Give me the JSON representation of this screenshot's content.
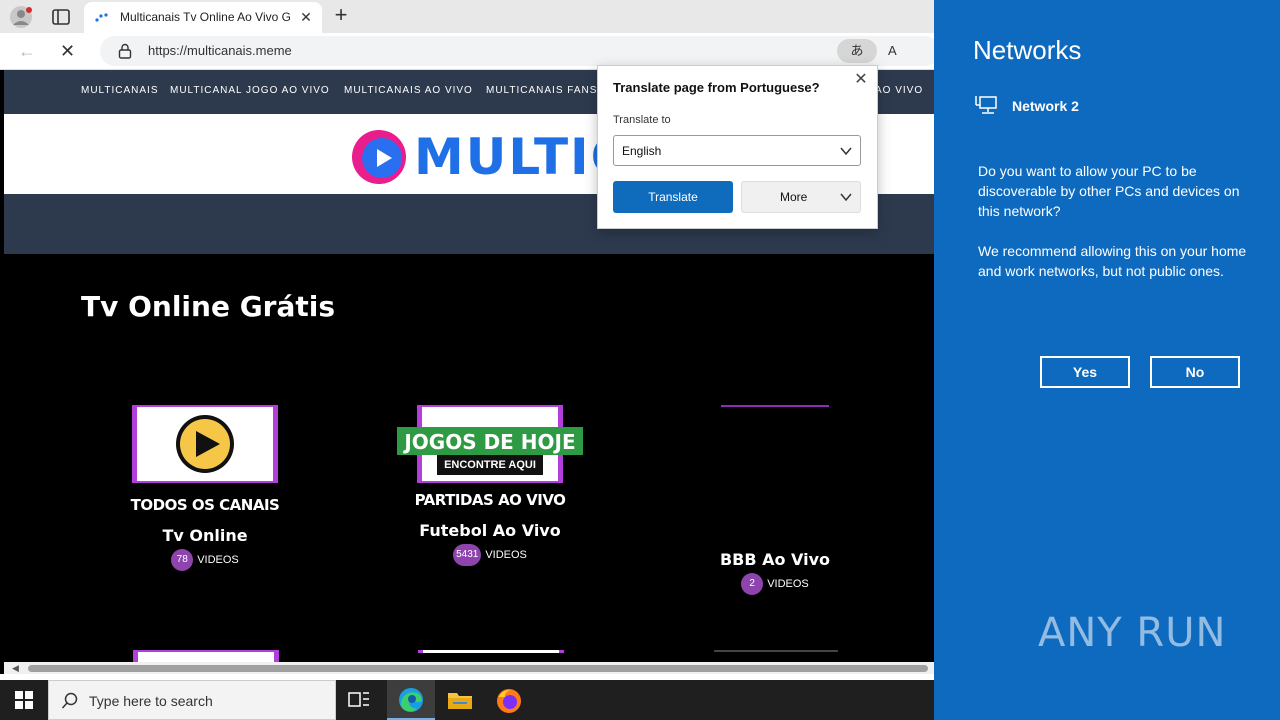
{
  "browser": {
    "tab_title": "Multicanais Tv Online Ao Vivo Gr",
    "url": "https://multicanais.meme",
    "translate_icon": "あ",
    "read_aloud_icon": "A"
  },
  "site": {
    "nav": [
      "MULTICANAIS",
      "MULTICANAL JOGO AO VIVO",
      "MULTICANAIS AO VIVO",
      "MULTICANAIS FANS",
      "AO VIVO"
    ],
    "logo_text": "MULTIC",
    "heading": "Tv Online Grátis",
    "cards": [
      {
        "caption": "TODOS OS CANAIS",
        "name": "Tv Online",
        "count": "78",
        "videos_label": "VIDEOS"
      },
      {
        "banner": "JOGOS DE HOJE",
        "banner_sub": "ENCONTRE AQUI",
        "caption": "PARTIDAS AO VIVO",
        "name": "Futebol Ao Vivo",
        "count": "5431",
        "videos_label": "VIDEOS"
      },
      {
        "name": "BBB Ao Vivo",
        "count": "2",
        "videos_label": "VIDEOS"
      }
    ]
  },
  "translate_popup": {
    "title": "Translate page from Portuguese?",
    "label": "Translate to",
    "selected_language": "English",
    "translate_button": "Translate",
    "more_button": "More"
  },
  "network_panel": {
    "title": "Networks",
    "network_name": "Network 2",
    "question": "Do you want to allow your PC to be discoverable by other PCs and devices on this network?",
    "recommendation": "We recommend allowing this on your home and work networks, but not public ones.",
    "yes": "Yes",
    "no": "No",
    "watermark": "ANY RUN"
  },
  "taskbar": {
    "search_placeholder": "Type here to search"
  },
  "colors": {
    "panel_blue": "#0e6abf",
    "nav_dark": "#2d3a4e",
    "accent_purple": "#8e44ad",
    "translate_blue": "#0f6cbd"
  }
}
